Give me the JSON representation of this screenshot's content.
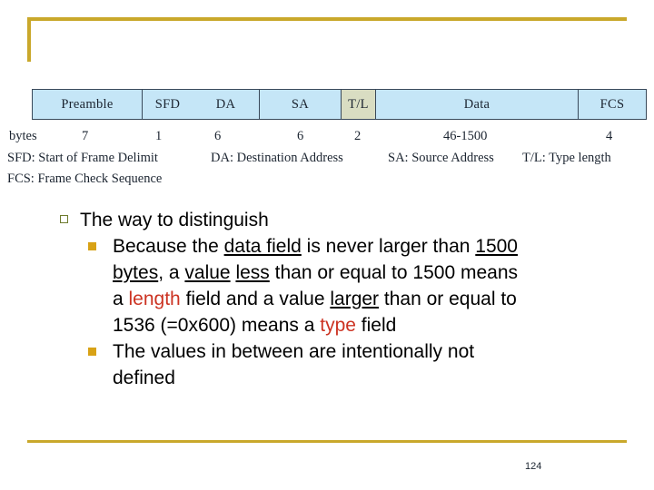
{
  "slide": {
    "accent_color": "#c9a82b",
    "page_number": "124"
  },
  "figure": {
    "fields": [
      {
        "label": "Preamble",
        "bytes": "7",
        "highlight": false
      },
      {
        "label": "SFD",
        "bytes": "1",
        "highlight": false
      },
      {
        "label": "DA",
        "bytes": "6",
        "highlight": false
      },
      {
        "label": "SA",
        "bytes": "6",
        "highlight": false
      },
      {
        "label": "T/L",
        "bytes": "2",
        "highlight": true
      },
      {
        "label": "Data",
        "bytes": "46-1500",
        "highlight": false
      },
      {
        "label": "FCS",
        "bytes": "4",
        "highlight": false
      }
    ],
    "bytes_row_label": "bytes",
    "cell_fill": "#c5e6f7",
    "highlight_fill": "#d9ddc2",
    "legend": {
      "line1": [
        "SFD: Start of Frame Delimit",
        "DA: Destination Address",
        "SA: Source Address",
        "T/L: Type length"
      ],
      "line2": "FCS: Frame Check Sequence"
    }
  },
  "content": {
    "bullet1": "The way to distinguish",
    "bullet2": {
      "seg1": "Because the ",
      "seg2_underline": "data field",
      "seg3": " is never larger than ",
      "seg4_underline": "1500",
      "seg5_underline": "bytes",
      "seg6": ", a ",
      "seg7_underline": "value",
      "seg8": " ",
      "seg9_underline": "less",
      "seg10": " than or equal to 1500 means",
      "seg11": "a ",
      "seg12_red": "length",
      "seg13": " field and a value ",
      "seg14_underline": "larger",
      "seg15": " than or equal to",
      "seg16": "1536 (=0x600) means a ",
      "seg17_red": "type",
      "seg18": " field"
    },
    "bullet3": {
      "line1": "The values in between are intentionally not",
      "line2": "defined"
    }
  }
}
